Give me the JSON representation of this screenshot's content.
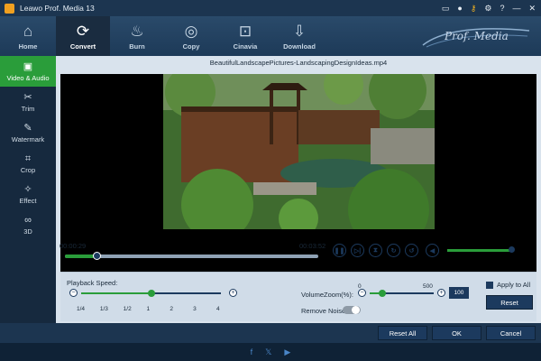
{
  "window": {
    "title": "Leawo Prof. Media 13",
    "icons": [
      "monitor-icon",
      "user-icon",
      "key-icon",
      "settings-icon",
      "help-icon",
      "minimize-icon",
      "close-icon"
    ]
  },
  "toolbar": {
    "tabs": [
      {
        "label": "Home",
        "icon": "home-icon"
      },
      {
        "label": "Convert",
        "icon": "convert-icon",
        "active": true
      },
      {
        "label": "Burn",
        "icon": "burn-icon"
      },
      {
        "label": "Copy",
        "icon": "copy-icon"
      },
      {
        "label": "Cinavia",
        "icon": "unlock-icon"
      },
      {
        "label": "Download",
        "icon": "download-icon"
      }
    ],
    "brand": "Prof. Media"
  },
  "sidebar": {
    "items": [
      {
        "label": "Video & Audio",
        "icon": "video-icon",
        "active": true
      },
      {
        "label": "Trim",
        "icon": "trim-icon"
      },
      {
        "label": "Watermark",
        "icon": "watermark-icon"
      },
      {
        "label": "Crop",
        "icon": "crop-icon"
      },
      {
        "label": "Effect",
        "icon": "effect-icon"
      },
      {
        "label": "3D",
        "icon": "3d-glasses-icon"
      }
    ]
  },
  "player": {
    "filename": "BeautifulLandscapePictures-LandscapingDesignIdeas.mp4",
    "current_time": "00:00:29",
    "total_time": "00:03:52",
    "progress_fraction": 0.125,
    "volume_fraction": 1.0,
    "controls": [
      "pause-icon",
      "step-icon",
      "snapshot-icon",
      "rotate-right-icon",
      "rotate-left-icon"
    ]
  },
  "settings": {
    "playback_speed_label": "Playback Speed:",
    "speed_ticks": [
      "1/4",
      "1/3",
      "1/2",
      "1",
      "2",
      "3",
      "4"
    ],
    "speed_selected_index": 3,
    "volume_zoom_label": "VolumeZoom(%):",
    "volume_zoom_min": "0",
    "volume_zoom_max": "500",
    "volume_zoom_value": "100",
    "remove_noise_label": "Remove Noise:",
    "remove_noise_on": false,
    "apply_to_all_label": "Apply to All",
    "apply_to_all_checked": true,
    "reset_label": "Reset"
  },
  "actions": {
    "reset_all": "Reset All",
    "ok": "OK",
    "cancel": "Cancel"
  },
  "footer": {
    "icons": [
      "facebook-icon",
      "x-icon",
      "youtube-icon"
    ]
  },
  "colors": {
    "accent_green": "#2a9d3a",
    "navy": "#1c3a5e",
    "panel_bg": "#d9e3ed"
  }
}
